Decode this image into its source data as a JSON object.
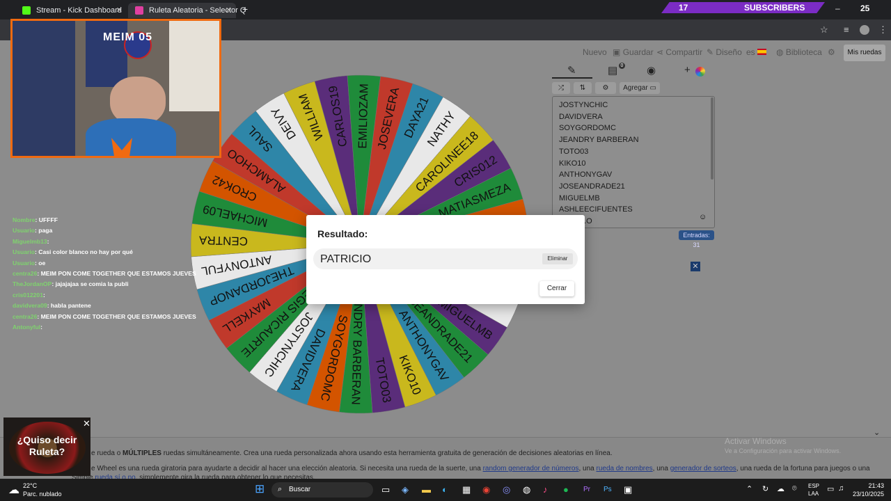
{
  "browser": {
    "tabs": [
      {
        "label": "Stream - Kick Dashboard",
        "icon_color": "#53fc18"
      },
      {
        "label": "Ruleta Aleatoria - Selector Q",
        "icon_color": "#e040a0"
      }
    ],
    "new_tab": "+",
    "overlay": {
      "subscribers_count": "17",
      "subscribers_label": "SUBSCRIBERS",
      "corner_number": "25"
    }
  },
  "toolbar": {
    "new": "Nuevo",
    "save": "Guardar",
    "share": "Compartir",
    "design": "Diseño",
    "language": "es",
    "library": "Biblioteca",
    "my_wheels": "Mis ruedas"
  },
  "panel": {
    "tabs": [
      "edit-icon",
      "results-icon",
      "hide-icon",
      "add-color-icon"
    ],
    "results_badge": "0",
    "buttons": {
      "shuffle": "shuffle-icon",
      "sort": "sort-icon",
      "gear": "gear-icon",
      "add": "Agregar"
    },
    "entries": [
      "JOSTYNCHIC",
      "DAVIDVERA",
      "SOYGORDOMC",
      "JEANDRY BARBERAN",
      "TOTO03",
      "KIKO10",
      "ANTHONYGAV",
      "JOSEANDRADE21",
      "MIGUELMB",
      "ASHLEECIFUENTES",
      "...O"
    ],
    "entries_count": "Entradas: 31"
  },
  "wheel": {
    "segments": [
      {
        "label": "JOSEVERA",
        "color": "#c0392b"
      },
      {
        "label": "DAYA21",
        "color": "#2e86a8"
      },
      {
        "label": "NATHY",
        "color": "#e8e8e8"
      },
      {
        "label": "CAROLINEE18",
        "color": "#c9b81d"
      },
      {
        "label": "CRIS012",
        "color": "#5a2d7a"
      },
      {
        "label": "MATIASMEZA",
        "color": "#1f8b3a"
      },
      {
        "label": "",
        "color": "#d35400"
      },
      {
        "label": "",
        "color": "#c0392b"
      },
      {
        "label": "",
        "color": "#2e86a8"
      },
      {
        "label": "",
        "color": "#e8e8e8"
      },
      {
        "label": "MIGUELMB",
        "color": "#5a2d7a"
      },
      {
        "label": "JOSEANDRADE21",
        "color": "#1f8b3a"
      },
      {
        "label": "ANTHONYGAV",
        "color": "#2e86a8"
      },
      {
        "label": "KIKO10",
        "color": "#c9b81d"
      },
      {
        "label": "TOTO03",
        "color": "#5a2d7a"
      },
      {
        "label": "JEANDRY BARBERAN",
        "color": "#1f8b3a"
      },
      {
        "label": "SOYGORDOMC",
        "color": "#d35400"
      },
      {
        "label": "DAVIDVERA",
        "color": "#2e86a8"
      },
      {
        "label": "JOSTYNCHIC",
        "color": "#e8e8e8"
      },
      {
        "label": "REGIS RICAURTE",
        "color": "#1f8b3a"
      },
      {
        "label": "MAYKELL",
        "color": "#c0392b"
      },
      {
        "label": "THEJORDANOP",
        "color": "#2e86a8"
      },
      {
        "label": "ANTONYFUL",
        "color": "#e8e8e8"
      },
      {
        "label": "CENTRA",
        "color": "#c9b81d"
      },
      {
        "label": "MICHAEL09",
        "color": "#1f8b3a"
      },
      {
        "label": "CROK42",
        "color": "#d35400"
      },
      {
        "label": "ALAMCHOO",
        "color": "#c0392b"
      },
      {
        "label": "SAUL",
        "color": "#2e86a8"
      },
      {
        "label": "DEIVY",
        "color": "#e8e8e8"
      },
      {
        "label": "WILLIAM",
        "color": "#c9b81d"
      },
      {
        "label": "CARLOS19",
        "color": "#5a2d7a"
      },
      {
        "label": "EMILIOZAM",
        "color": "#1f8b3a"
      }
    ]
  },
  "modal": {
    "title": "Resultado:",
    "result": "PATRICIO",
    "remove": "Eliminar",
    "close": "Cerrar"
  },
  "description": {
    "line1_pre": "e rueda o ",
    "line1_bold": "MÚLTIPLES",
    "line1_post": " ruedas simultáneamente. Crea una rueda personalizada ahora usando esta herramienta gratuita de generación de decisiones aleatorias en línea.",
    "line2_pre": "e Wheel es una rueda giratoria para ayudarte a decidir al hacer una elección aleatoria. Si necesita una rueda de la suerte, una ",
    "link1": "random generador de números",
    "sep1": ", una ",
    "link2": "rueda de nombres",
    "sep2": ", una ",
    "link3": "generador de sorteos",
    "line2_post": ", una rueda de la fortuna para juegos o una",
    "line3_pre": "Simple ",
    "link4": "rueda sí o no",
    "line3_post": ", simplemente gira la rueda para obtener lo que necesitas."
  },
  "watermark": {
    "title": "Activar Windows",
    "subtitle": "Ve a Configuración para activar Windows."
  },
  "stream": {
    "cam_title": "MEIM 05",
    "popup_text": "¿Quiso decir Ruleta?"
  },
  "chat": [
    {
      "user": "Nombre",
      "msg": ": UFFFF"
    },
    {
      "user": "Usuario",
      "msg": ": paga"
    },
    {
      "user": "Miguelmb13",
      "msg": ": "
    },
    {
      "user": "Usuario",
      "msg": ": Casi color blanco no hay por qué"
    },
    {
      "user": "Usuario",
      "msg": ": oe"
    },
    {
      "user": "centra26",
      "msg": ": MEIM PON COME TOGETHER QUE ESTAMOS JUEVES"
    },
    {
      "user": "TheJordanOP",
      "msg": ": jajajajaa se comia la publi"
    },
    {
      "user": "cris012201",
      "msg": ": "
    },
    {
      "user": "davidvera09",
      "msg": ": habla pantene"
    },
    {
      "user": "centra26",
      "msg": ": MEIM PON COME TOGETHER QUE ESTAMOS JUEVES"
    },
    {
      "user": "Antonyful",
      "msg": ": "
    }
  ],
  "taskbar": {
    "weather_temp": "22°C",
    "weather_desc": "Parc. nublado",
    "search": "Buscar",
    "lang_top": "ESP",
    "lang_bot": "LAA",
    "time": "21:43",
    "date": "23/10/2025"
  }
}
